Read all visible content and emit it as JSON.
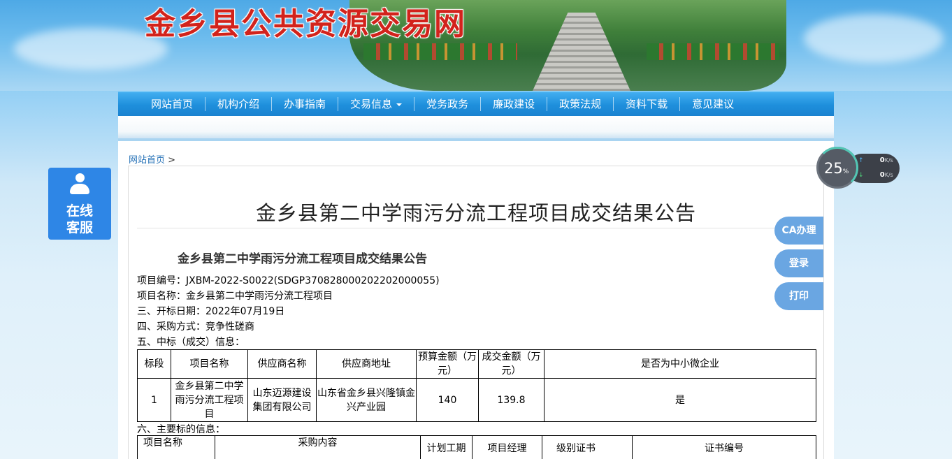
{
  "site": {
    "title": "金乡县公共资源交易网"
  },
  "nav": {
    "items": [
      {
        "label": "网站首页"
      },
      {
        "label": "机构介绍"
      },
      {
        "label": "办事指南"
      },
      {
        "label": "交易信息"
      },
      {
        "label": "党务政务"
      },
      {
        "label": "廉政建设"
      },
      {
        "label": "政策法规"
      },
      {
        "label": "资料下载"
      },
      {
        "label": "意见建议"
      }
    ]
  },
  "breadcrumb": {
    "home": "网站首页",
    "separator": ">"
  },
  "article": {
    "title": "金乡县第二中学雨污分流工程项目成交结果公告",
    "inner_title": "金乡县第二中学雨污分流工程项目成交结果公告",
    "lines": [
      "项目编号：JXBM-2022-S0022(SDGP370828000202202000055)",
      "项目名称：金乡县第二中学雨污分流工程项目",
      "三、开标日期：2022年07月19日",
      "四、采购方式：竞争性磋商",
      "五、中标（成交）信息："
    ],
    "table1": {
      "headers": [
        "标段",
        "项目名称",
        "供应商名称",
        "供应商地址",
        "预算金额（万元）",
        "成交金额（万元）",
        "是否为中小微企业"
      ],
      "rows": [
        [
          "1",
          "金乡县第二中学雨污分流工程项目",
          "山东迈源建设集团有限公司",
          "山东省金乡县兴隆镇金兴产业园",
          "140",
          "139.8",
          "是"
        ]
      ]
    },
    "section6": "六、主要标的信息：",
    "table2": {
      "headers": [
        "项目名称",
        "采购内容",
        "计划工期",
        "项目经理",
        "级别证书",
        "证书编号"
      ]
    }
  },
  "kefu": {
    "line1": "在线",
    "line2": "客服"
  },
  "side_buttons": {
    "ca": "CA办理",
    "login": "登录",
    "print": "打印"
  },
  "speed": {
    "percent": "25",
    "percent_unit": "%",
    "upload": "0",
    "download": "0",
    "unit": "K/s"
  }
}
